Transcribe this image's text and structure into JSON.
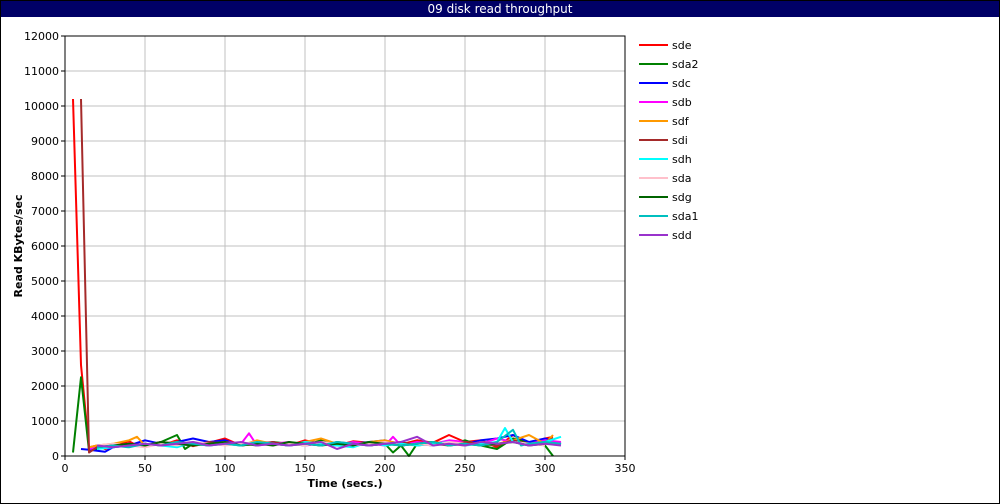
{
  "window": {
    "title": "09 disk read throughput"
  },
  "chart_data": {
    "type": "line",
    "title": "09 disk read throughput",
    "xlabel": "Time (secs.)",
    "ylabel": "Read KBytes/sec",
    "xlim": [
      0,
      350
    ],
    "ylim": [
      0,
      12000
    ],
    "xticks": [
      0,
      50,
      100,
      150,
      200,
      250,
      300,
      350
    ],
    "yticks": [
      0,
      1000,
      2000,
      3000,
      4000,
      5000,
      6000,
      7000,
      8000,
      9000,
      10000,
      11000,
      12000
    ],
    "grid": true,
    "legend_position": "right",
    "colors": {
      "title_bar": "#000066",
      "grid": "#c0c0c0"
    },
    "series": [
      {
        "name": "sde",
        "color": "#ff0000",
        "x": [
          5,
          10,
          15,
          20,
          25,
          30,
          35,
          40,
          45,
          50,
          60,
          70,
          80,
          90,
          100,
          110,
          120,
          130,
          140,
          150,
          160,
          170,
          180,
          190,
          200,
          210,
          220,
          230,
          240,
          250,
          260,
          270,
          280,
          290,
          300,
          305
        ],
        "y": [
          10200,
          2600,
          250,
          300,
          200,
          280,
          350,
          420,
          300,
          350,
          300,
          450,
          280,
          380,
          500,
          300,
          420,
          350,
          300,
          450,
          350,
          300,
          420,
          380,
          400,
          330,
          450,
          380,
          600,
          400,
          450,
          250,
          600,
          350,
          500,
          550
        ]
      },
      {
        "name": "sda2",
        "color": "#008000",
        "x": [
          5,
          10,
          15,
          20,
          30,
          40,
          50,
          60,
          70,
          75,
          80,
          90,
          100,
          110,
          120,
          130,
          140,
          150,
          160,
          170,
          180,
          190,
          200,
          205,
          210,
          215,
          220,
          230,
          240,
          250,
          260,
          270,
          280,
          290,
          300,
          305
        ],
        "y": [
          100,
          2250,
          150,
          200,
          280,
          350,
          300,
          400,
          600,
          200,
          350,
          300,
          400,
          350,
          300,
          400,
          350,
          300,
          450,
          300,
          400,
          300,
          350,
          100,
          300,
          0,
          350,
          400,
          300,
          450,
          300,
          200,
          500,
          400,
          300,
          0
        ]
      },
      {
        "name": "sdc",
        "color": "#0000ff",
        "x": [
          10,
          15,
          20,
          25,
          30,
          40,
          50,
          60,
          70,
          80,
          90,
          100,
          110,
          120,
          130,
          140,
          150,
          160,
          170,
          180,
          190,
          200,
          210,
          220,
          230,
          240,
          250,
          260,
          270,
          280,
          290,
          300,
          310
        ],
        "y": [
          200,
          180,
          150,
          120,
          250,
          300,
          450,
          350,
          400,
          500,
          400,
          450,
          300,
          400,
          350,
          300,
          400,
          350,
          300,
          350,
          400,
          450,
          300,
          350,
          300,
          400,
          350,
          450,
          500,
          600,
          400,
          500,
          350
        ]
      },
      {
        "name": "sdb",
        "color": "#ff00ff",
        "x": [
          15,
          20,
          30,
          40,
          50,
          60,
          70,
          80,
          90,
          100,
          110,
          115,
          120,
          130,
          140,
          150,
          160,
          170,
          180,
          190,
          200,
          205,
          210,
          220,
          230,
          240,
          250,
          260,
          270,
          280,
          290,
          300,
          310
        ],
        "y": [
          200,
          250,
          300,
          350,
          300,
          400,
          300,
          350,
          300,
          400,
          350,
          650,
          300,
          350,
          400,
          300,
          350,
          300,
          400,
          350,
          300,
          550,
          300,
          400,
          350,
          450,
          400,
          350,
          500,
          400,
          350,
          450,
          400
        ]
      },
      {
        "name": "sdf",
        "color": "#ff9900",
        "x": [
          15,
          20,
          30,
          40,
          45,
          50,
          60,
          70,
          80,
          90,
          100,
          110,
          120,
          130,
          140,
          150,
          160,
          170,
          180,
          190,
          200,
          210,
          220,
          230,
          240,
          250,
          260,
          270,
          280,
          290,
          300,
          305
        ],
        "y": [
          250,
          300,
          350,
          450,
          550,
          300,
          350,
          400,
          300,
          350,
          400,
          300,
          450,
          350,
          300,
          400,
          500,
          350,
          300,
          400,
          450,
          350,
          300,
          400,
          350,
          300,
          400,
          350,
          450,
          600,
          350,
          600
        ]
      },
      {
        "name": "sdi",
        "color": "#a52a2a",
        "x": [
          10,
          15,
          20,
          30,
          40,
          50,
          60,
          70,
          80,
          90,
          100,
          110,
          120,
          130,
          140,
          150,
          160,
          170,
          180,
          190,
          200,
          210,
          220,
          230,
          240,
          250,
          260,
          270,
          280,
          290,
          300,
          305
        ],
        "y": [
          10200,
          100,
          250,
          300,
          350,
          300,
          400,
          350,
          300,
          400,
          350,
          300,
          350,
          400,
          300,
          350,
          300,
          400,
          350,
          300,
          350,
          400,
          300,
          350,
          300,
          400,
          350,
          300,
          450,
          350,
          400,
          500
        ]
      },
      {
        "name": "sdh",
        "color": "#00ffff",
        "x": [
          20,
          30,
          40,
          50,
          60,
          70,
          80,
          90,
          100,
          110,
          120,
          130,
          140,
          150,
          160,
          170,
          180,
          190,
          200,
          210,
          220,
          230,
          240,
          250,
          260,
          270,
          275,
          280,
          290,
          300,
          310
        ],
        "y": [
          200,
          250,
          300,
          350,
          300,
          250,
          400,
          300,
          350,
          300,
          400,
          350,
          300,
          400,
          350,
          300,
          250,
          400,
          300,
          350,
          300,
          350,
          400,
          300,
          350,
          400,
          800,
          400,
          350,
          400,
          550
        ]
      },
      {
        "name": "sda",
        "color": "#ffc0cb",
        "x": [
          20,
          30,
          40,
          50,
          60,
          70,
          80,
          90,
          100,
          110,
          120,
          130,
          140,
          150,
          160,
          170,
          180,
          190,
          200,
          210,
          220,
          230,
          240,
          250,
          260,
          270,
          280,
          290,
          300
        ],
        "y": [
          300,
          350,
          300,
          250,
          350,
          300,
          400,
          350,
          300,
          350,
          400,
          300,
          350,
          300,
          400,
          350,
          300,
          350,
          400,
          300,
          350,
          300,
          400,
          350,
          300,
          350,
          400,
          350,
          300
        ]
      },
      {
        "name": "sdg",
        "color": "#006400",
        "x": [
          20,
          30,
          40,
          50,
          60,
          70,
          80,
          90,
          100,
          110,
          120,
          130,
          140,
          150,
          160,
          170,
          180,
          190,
          200,
          210,
          220,
          230,
          240,
          250,
          260,
          270,
          280,
          290,
          300
        ],
        "y": [
          250,
          300,
          350,
          300,
          400,
          350,
          300,
          350,
          400,
          300,
          350,
          300,
          400,
          350,
          300,
          350,
          300,
          400,
          350,
          300,
          350,
          400,
          300,
          350,
          300,
          350,
          400,
          300,
          350
        ]
      },
      {
        "name": "sda1",
        "color": "#00bfbf",
        "x": [
          20,
          30,
          40,
          50,
          60,
          70,
          80,
          90,
          100,
          110,
          120,
          130,
          140,
          150,
          160,
          170,
          180,
          190,
          200,
          210,
          220,
          230,
          240,
          250,
          260,
          270,
          280,
          285,
          290,
          300,
          310
        ],
        "y": [
          250,
          300,
          250,
          350,
          300,
          400,
          350,
          300,
          350,
          300,
          400,
          350,
          300,
          350,
          300,
          400,
          350,
          300,
          350,
          300,
          350,
          400,
          300,
          350,
          300,
          400,
          750,
          300,
          350,
          400,
          350
        ]
      },
      {
        "name": "sdd",
        "color": "#9932cc",
        "x": [
          20,
          30,
          40,
          50,
          60,
          70,
          80,
          90,
          100,
          110,
          120,
          130,
          140,
          150,
          160,
          170,
          180,
          190,
          200,
          210,
          220,
          230,
          240,
          250,
          260,
          270,
          280,
          290,
          300,
          310
        ],
        "y": [
          300,
          250,
          300,
          350,
          300,
          350,
          400,
          300,
          350,
          400,
          300,
          350,
          300,
          350,
          400,
          200,
          350,
          300,
          350,
          400,
          550,
          300,
          350,
          300,
          400,
          350,
          400,
          300,
          350,
          300
        ]
      }
    ]
  }
}
